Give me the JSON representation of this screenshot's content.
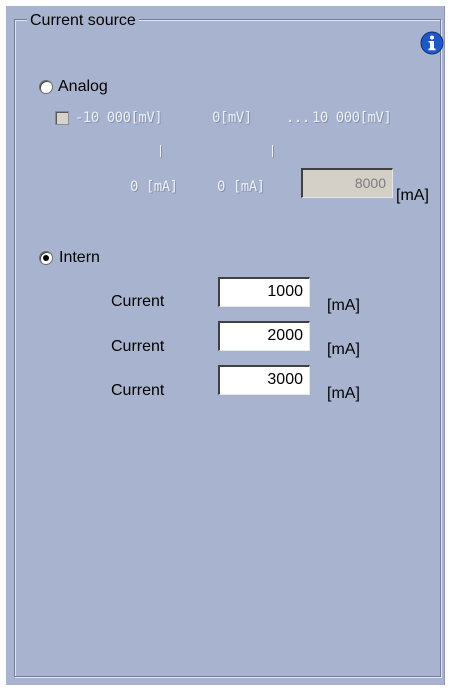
{
  "group": {
    "title": "Current source",
    "info_icon": "info-icon"
  },
  "analog": {
    "label": "Analog",
    "selected": false,
    "checkbox_checked": false,
    "range_low_mv": "-10 000[mV]",
    "range_mid_mv": "0[mV]",
    "range_ellipsis": "...",
    "range_high_mv": "10 000[mV]",
    "low_ma": "0 [mA]",
    "mid_ma": "0 [mA]",
    "max_value": "8000",
    "unit": "[mA]"
  },
  "intern": {
    "label": "Intern",
    "selected": true,
    "rows": [
      {
        "label": "Current",
        "value": "1000",
        "unit": "[mA]"
      },
      {
        "label": "Current",
        "value": "2000",
        "unit": "[mA]"
      },
      {
        "label": "Current",
        "value": "3000",
        "unit": "[mA]"
      }
    ]
  },
  "colors": {
    "panel_background": "#a8b4cf",
    "info_icon_blue": "#1f57c9"
  }
}
